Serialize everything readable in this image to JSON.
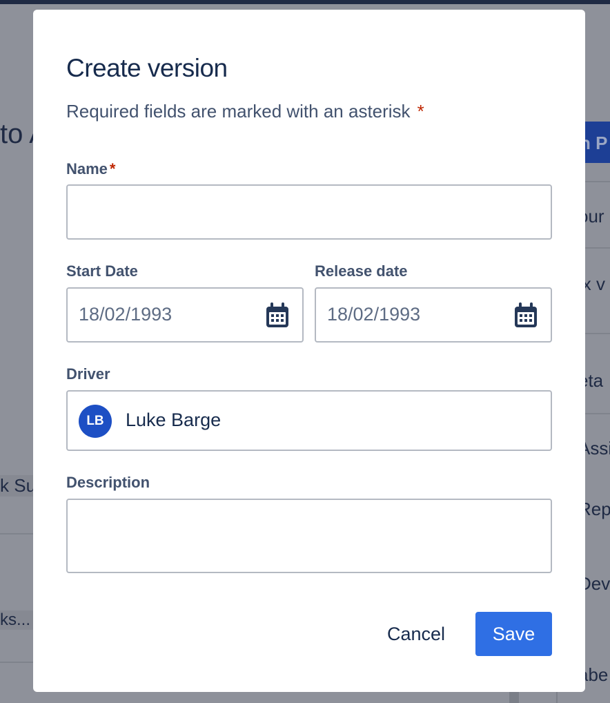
{
  "background": {
    "title_fragment": "to A",
    "button_fragment": "n P",
    "right_items": [
      "our",
      "ix v",
      "eta",
      "Assi",
      "Rep",
      "Dev",
      "abe"
    ],
    "left_items": [
      "k Su",
      "ks..."
    ]
  },
  "modal": {
    "title": "Create version",
    "required_note": "Required fields are marked with an asterisk",
    "asterisk": "*",
    "fields": {
      "name": {
        "label": "Name",
        "required_mark": "*",
        "value": ""
      },
      "start_date": {
        "label": "Start Date",
        "value": "18/02/1993",
        "icon": "calendar-icon"
      },
      "release_date": {
        "label": "Release date",
        "value": "18/02/1993",
        "icon": "calendar-icon"
      },
      "driver": {
        "label": "Driver",
        "avatar_initials": "LB",
        "value": "Luke Barge"
      },
      "description": {
        "label": "Description",
        "value": ""
      }
    },
    "actions": {
      "cancel": "Cancel",
      "save": "Save"
    }
  },
  "colors": {
    "primary": "#2f6fe4",
    "text_primary": "#172b4d",
    "text_secondary": "#42526e",
    "required": "#bf2600",
    "avatar": "#1d4fc4"
  }
}
